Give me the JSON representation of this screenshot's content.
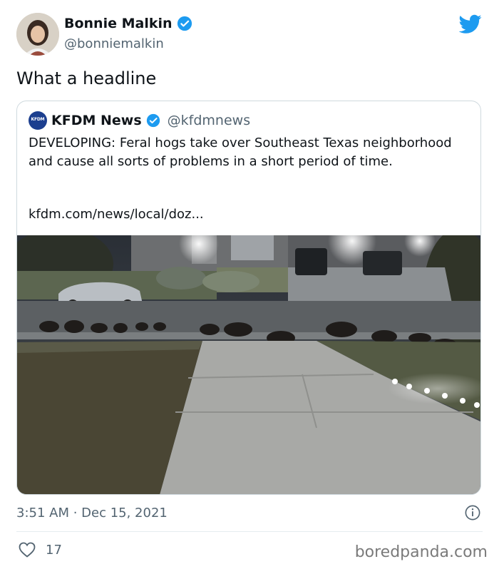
{
  "author": {
    "name": "Bonnie Malkin",
    "handle": "@bonniemalkin"
  },
  "tweet": {
    "text": "What a headline",
    "timestamp": "3:51 AM · Dec 15, 2021",
    "likes": "17"
  },
  "quote": {
    "logo_text": "KFDM",
    "name": "KFDM News",
    "handle": "@kfdmnews",
    "text": "DEVELOPING: Feral hogs take over Southeast Texas neighborhood and cause all sorts of problems in a short period of time.",
    "link": "kfdm.com/news/local/doz..."
  },
  "brand": "boredpanda.com",
  "colors": {
    "twitter_blue": "#1d9bf0",
    "secondary_text": "#536471",
    "border": "#cfd9de"
  },
  "icons": [
    "verified-badge-icon",
    "twitter-bird-icon",
    "info-icon",
    "heart-icon"
  ]
}
